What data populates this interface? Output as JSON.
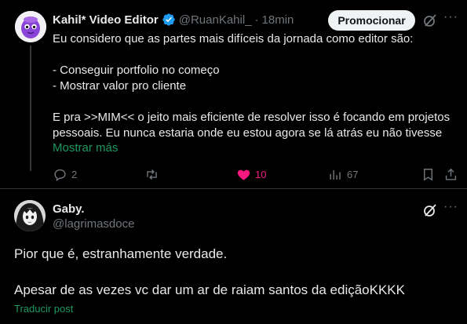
{
  "post": {
    "author_name": "Kahil* Video Editor",
    "handle": "@RuanKahil_",
    "separator": "·",
    "time": "18min",
    "promote_label": "Promocionar",
    "text_lines": [
      "Eu considero que as partes mais difíceis da jornada como editor são:",
      "",
      "- Conseguir portfolio no começo",
      "- Mostrar valor pro cliente",
      "",
      "E pra >>MIM<< o jeito mais eficiente de resolver isso é focando em projetos",
      "pessoais. Eu nunca estaria onde eu estou agora se lá atrás eu não tivesse"
    ],
    "show_more": "Mostrar más",
    "replies": "2",
    "reposts": "",
    "likes": "10",
    "views": "67",
    "colors": {
      "like": "#f91880",
      "link": "#1d9a5f",
      "verified": "#1d9bf0"
    }
  },
  "reply": {
    "author_name": "Gaby.",
    "handle": "@lagrimasdoce",
    "line1": "Pior que é, estranhamente verdade.",
    "line2": "Apesar de as vezes vc dar um ar de raiam santos da ediçãoKKKK",
    "translate": "Traducir post"
  },
  "icons": [
    "avatar",
    "verified-badge-icon",
    "grok-icon",
    "more-icon",
    "reply-icon",
    "repost-icon",
    "like-icon",
    "views-icon",
    "bookmark-icon",
    "share-icon"
  ]
}
